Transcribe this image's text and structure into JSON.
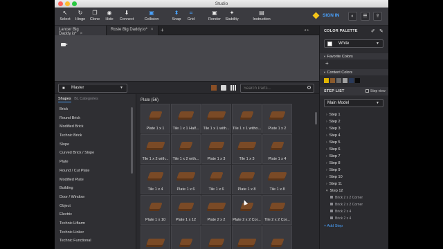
{
  "window": {
    "title": "Studio"
  },
  "toolbar": {
    "tools": [
      {
        "label": "Select",
        "icon": "cursor-icon"
      },
      {
        "label": "Hinge",
        "icon": "hinge-icon"
      },
      {
        "label": "Clone",
        "icon": "clone-icon"
      },
      {
        "label": "Hide",
        "icon": "eye-icon"
      },
      {
        "label": "Connect",
        "icon": "connect-icon"
      },
      {
        "label": "Collision",
        "icon": "collision-icon"
      },
      {
        "label": "Snap",
        "icon": "snap-icon"
      },
      {
        "label": "Grid",
        "icon": "grid-icon"
      },
      {
        "label": "Render",
        "icon": "camera-icon"
      },
      {
        "label": "Stability",
        "icon": "stability-icon"
      },
      {
        "label": "Instruction",
        "icon": "instruction-icon"
      }
    ],
    "signin": "SIGN IN"
  },
  "tabs": [
    {
      "label": "Lancer Big Daddy.io*"
    },
    {
      "label": "Rosie Big Daddy.io*"
    }
  ],
  "parts_panel": {
    "model_select": "Master",
    "search_placeholder": "Search Parts...",
    "category_tabs": [
      "Shapes",
      "BL Categories"
    ],
    "categories": [
      "Brick",
      "Round Brick",
      "Modified Brick",
      "Technic Brick",
      "Slope",
      "Curved Brick / Slope",
      "Plate",
      "Round / Cut Plate",
      "Modified Plate",
      "Building",
      "Door / Window",
      "Object",
      "Electric",
      "Technic Liftarm",
      "Technic Linker",
      "Technic Functional"
    ],
    "group_header": "Plate (56)",
    "parts": [
      "Plate 1 x 1",
      "Tile 1 x 1 Half...",
      "Tile 1 x 1 with...",
      "Tile 1 x 1 witho...",
      "Plate 1 x 2",
      "Tile 1 x 2 with...",
      "Tile 1 x 2 with...",
      "Plate 1 x 3",
      "Tile 1 x 3",
      "Plate 1 x 4",
      "Tile 1 x 4",
      "Plate 1 x 6",
      "Tile 1 x 6",
      "Plate 1 x 8",
      "Tile 1 x 8",
      "Plate 1 x 10",
      "Plate 1 x 12",
      "Plate 2 x 2",
      "Plate 2 x 2 Cor...",
      "Tile 2 x 2 Cor...",
      "",
      "",
      "",
      "",
      ""
    ]
  },
  "right_panel": {
    "color_palette": "COLOR PALETTE",
    "selected_color": "White",
    "favorite_colors": "Favorite Colors",
    "content_colors": "Content Colors",
    "content_swatches": [
      "#e0b400",
      "#8a5a2c",
      "#6a6a6a",
      "#a0a0a0",
      "#2a3a5a",
      "#0a0a0a"
    ],
    "step_list": "STEP LIST",
    "step_view": "Step view",
    "model": "Main Model",
    "steps": [
      "Step 1",
      "Step 2",
      "Step 3",
      "Step 4",
      "Step 5",
      "Step 6",
      "Step 7",
      "Step 8",
      "Step 9",
      "Step 10",
      "Step 11",
      "Step 12"
    ],
    "substeps": [
      "Brick 2 x 2 Corner",
      "Brick 2 x 2 Corner",
      "Brick 2 x 4",
      "Brick 2 x 4"
    ],
    "add_step": "+ Add Step"
  },
  "colors": {
    "accent": "#4aa3ff",
    "brick_brown": "#7a4a26"
  }
}
